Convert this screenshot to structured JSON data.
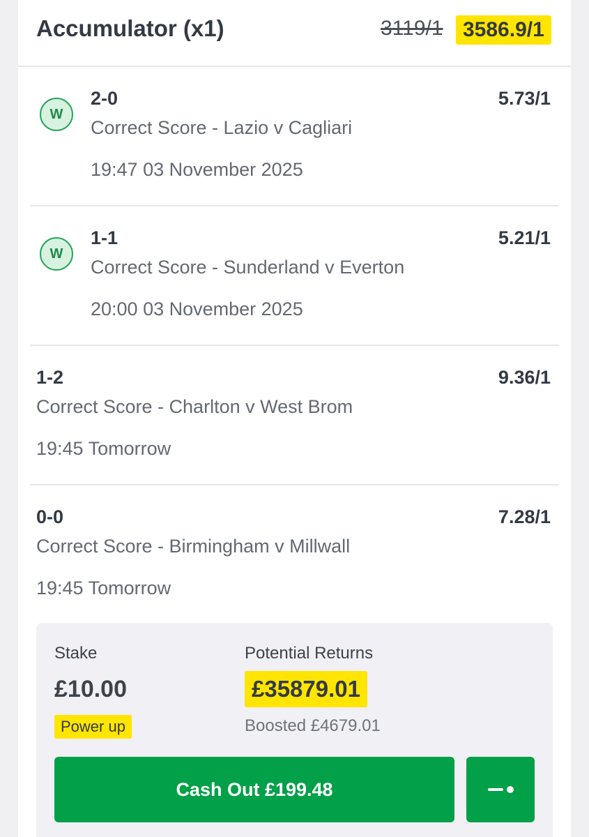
{
  "header": {
    "title": "Accumulator (x1)",
    "original_odds": "3119/1",
    "boosted_odds": "3586.9/1",
    "highlight_color": "#ffe500"
  },
  "legs": [
    {
      "status": "won",
      "badge": "W",
      "score": "2-0",
      "market": "Correct Score - Lazio v Cagliari",
      "time": "19:47 03 November 2025",
      "odds": "5.73/1"
    },
    {
      "status": "won",
      "badge": "W",
      "score": "1-1",
      "market": "Correct Score - Sunderland v Everton",
      "time": "20:00 03 November 2025",
      "odds": "5.21/1"
    },
    {
      "status": "pending",
      "score": "1-2",
      "market": "Correct Score - Charlton v West Brom",
      "time": "19:45 Tomorrow",
      "odds": "9.36/1"
    },
    {
      "status": "pending",
      "score": "0-0",
      "market": "Correct Score - Birmingham v Millwall",
      "time": "19:45 Tomorrow",
      "odds": "7.28/1"
    }
  ],
  "summary": {
    "stake_label": "Stake",
    "stake_value": "£10.00",
    "power_up": "Power up",
    "returns_label": "Potential Returns",
    "returns_value": "£35879.01",
    "boosted_note": "Boosted £4679.01",
    "cashout_label": "Cash Out £199.48",
    "accent_color": "#02a048",
    "slider_icon": "partial-cashout-slider-icon"
  }
}
